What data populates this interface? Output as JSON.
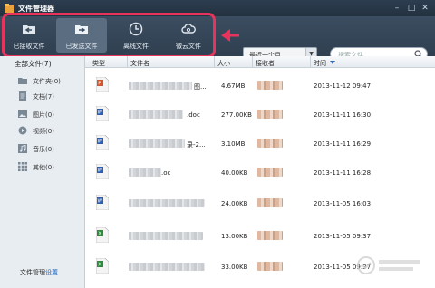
{
  "window": {
    "title": "文件管理器"
  },
  "toolbar": {
    "tabs": [
      {
        "label": "已接收文件",
        "icon": "folder-in-icon"
      },
      {
        "label": "已发送文件",
        "icon": "folder-out-icon"
      },
      {
        "label": "离线文件",
        "icon": "clock-icon"
      },
      {
        "label": "微云文件",
        "icon": "cloud-icon"
      }
    ],
    "active_tab": 1,
    "highlight_color": "#e8335c"
  },
  "filter": {
    "time_range": "最近一个月"
  },
  "search": {
    "placeholder": "搜索文件"
  },
  "sidebar": {
    "all_files": "全部文件(7)",
    "items": [
      {
        "label": "文件夹(0)",
        "icon": "folder-icon"
      },
      {
        "label": "文档(7)",
        "icon": "document-icon"
      },
      {
        "label": "图片(0)",
        "icon": "image-icon"
      },
      {
        "label": "视频(0)",
        "icon": "video-icon"
      },
      {
        "label": "音乐(0)",
        "icon": "music-icon"
      },
      {
        "label": "其他(0)",
        "icon": "grid-icon"
      }
    ],
    "footer_text": "文件管理",
    "footer_link": "设置"
  },
  "table": {
    "columns": [
      "类型",
      "文件名",
      "大小",
      "接收者",
      "时间"
    ],
    "rows": [
      {
        "type_icon": "ppt-file-icon",
        "name_visible": "图...",
        "size": "4.67MB",
        "time": "2013-11-12 09:47"
      },
      {
        "type_icon": "word-file-icon",
        "name_visible": ".doc",
        "size": "277.00KB",
        "time": "2013-11-11 16:30"
      },
      {
        "type_icon": "word-file-icon",
        "name_visible": "录-2...",
        "size": "3.10MB",
        "time": "2013-11-11 16:29"
      },
      {
        "type_icon": "word-file-icon",
        "name_visible": ".oc",
        "size": "40.00KB",
        "time": "2013-11-11 16:28"
      },
      {
        "type_icon": "word-file-icon",
        "name_visible": "",
        "size": "24.00KB",
        "time": "2013-11-05 16:03"
      },
      {
        "type_icon": "excel-file-icon",
        "name_visible": "",
        "size": "13.00KB",
        "time": "2013-11-05 09:37"
      },
      {
        "type_icon": "excel-file-icon",
        "name_visible": "",
        "size": "33.00KB",
        "time": "2013-11-05 09:37"
      }
    ]
  }
}
